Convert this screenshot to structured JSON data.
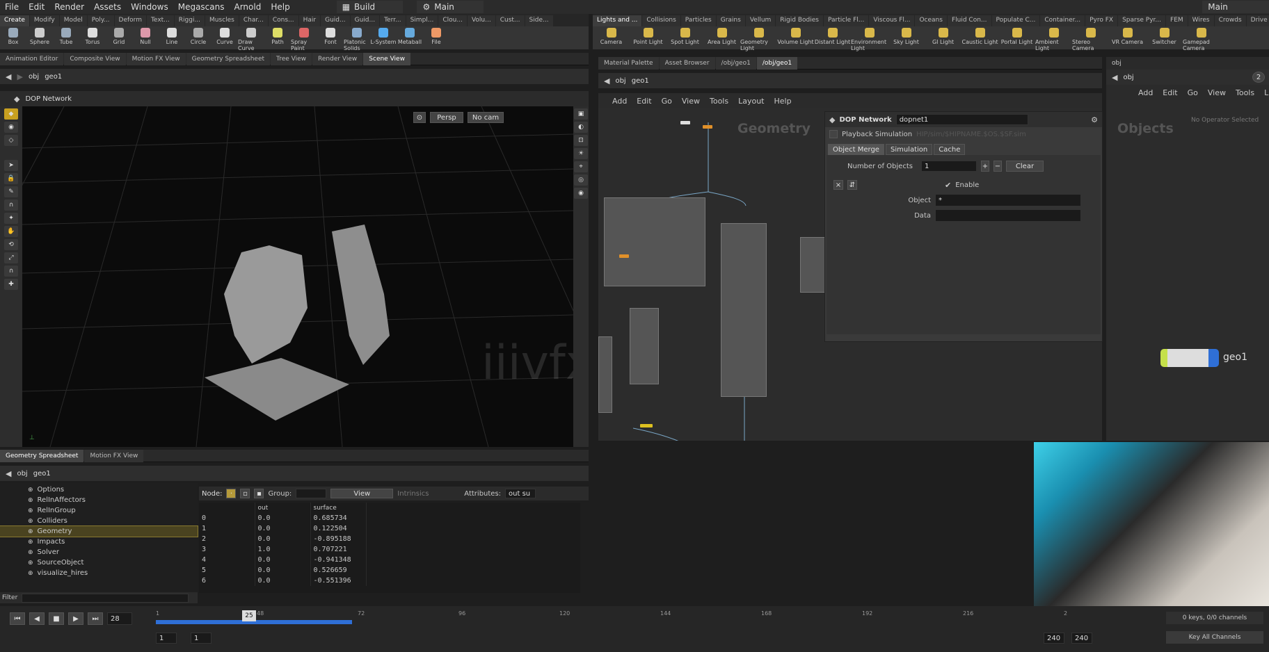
{
  "menubar": {
    "items": [
      "File",
      "Edit",
      "Render",
      "Assets",
      "Windows",
      "Megascans",
      "Arnold",
      "Help"
    ],
    "desktop": "Build",
    "session": "Main",
    "right_session": "Main"
  },
  "shelf_tabs": [
    "Create",
    "Modify",
    "Model",
    "Poly...",
    "Deform",
    "Text...",
    "Riggi...",
    "Muscles",
    "Char...",
    "Cons...",
    "Hair",
    "Guid...",
    "Guid...",
    "Terr...",
    "Simpl...",
    "Clou...",
    "Volu...",
    "Cust...",
    "Side..."
  ],
  "shelf_tools": [
    "Box",
    "Sphere",
    "Tube",
    "Torus",
    "Grid",
    "Null",
    "Line",
    "Circle",
    "Curve",
    "Draw Curve",
    "Path",
    "Spray Paint",
    "Font",
    "Platonic Solids",
    "L-System",
    "Metaball",
    "File"
  ],
  "light_tabs": [
    "Lights and ...",
    "Collisions",
    "Particles",
    "Grains",
    "Vellum",
    "Rigid Bodies",
    "Particle Fl...",
    "Viscous Fl...",
    "Oceans",
    "Fluid Con...",
    "Populate C...",
    "Container...",
    "Pyro FX",
    "Sparse Pyr...",
    "FEM",
    "Wires",
    "Crowds",
    "Drive Sim..."
  ],
  "light_tools": [
    "Camera",
    "Point Light",
    "Spot Light",
    "Area Light",
    "Geometry Light",
    "Volume Light",
    "Distant Light",
    "Environment Light",
    "Sky Light",
    "GI Light",
    "Caustic Light",
    "Portal Light",
    "Ambient Light",
    "Stereo Camera",
    "VR Camera",
    "Switcher",
    "Gamepad Camera"
  ],
  "left_tabs": [
    "Animation Editor",
    "Composite View",
    "Motion FX View",
    "Geometry Spreadsheet",
    "Tree View",
    "Render View",
    "Scene View"
  ],
  "path": {
    "root": "obj",
    "node": "geo1"
  },
  "viewport": {
    "title": "DOP Network",
    "persp": "Persp",
    "cam": "No cam"
  },
  "bottom_tabs": [
    "Geometry Spreadsheet",
    "Motion FX View"
  ],
  "tree_items": [
    "Options",
    "RelInAffectors",
    "RelInGroup",
    "Colliders",
    "Geometry",
    "Impacts",
    "Solver",
    "SourceObject",
    "visualize_hires"
  ],
  "sheet": {
    "node_label": "Node:",
    "group_label": "Group:",
    "view_label": "View",
    "intrinsics_label": "Intrinsics",
    "attributes_label": "Attributes:",
    "attributes_value": "out su",
    "columns": [
      "out",
      "surface"
    ],
    "rows": [
      [
        "0",
        "0.0",
        "0.685734"
      ],
      [
        "1",
        "0.0",
        "0.122504"
      ],
      [
        "2",
        "0.0",
        "-0.895188"
      ],
      [
        "3",
        "1.0",
        "0.707221"
      ],
      [
        "4",
        "0.0",
        "-0.941348"
      ],
      [
        "5",
        "0.0",
        "0.526659"
      ],
      [
        "6",
        "0.0",
        "-0.551396"
      ]
    ]
  },
  "filter_label": "Filter",
  "net_tabs": [
    "Material Palette",
    "Asset Browser",
    "/obj/geo1",
    "/obj/geo1"
  ],
  "net_menu": [
    "Add",
    "Edit",
    "Go",
    "View",
    "Tools",
    "Layout",
    "Help"
  ],
  "net_context": "Geometry",
  "params": {
    "type": "DOP Network",
    "name": "dopnet1",
    "playback": "Playback Simulation",
    "sim_path": "HIP/sim/$HIPNAME.$OS.$SF.sim",
    "tabs": [
      "Object Merge",
      "Simulation",
      "Cache"
    ],
    "num_objects_label": "Number of Objects",
    "num_objects": "1",
    "clear": "Clear",
    "enable": "Enable",
    "object_label": "Object",
    "object_value": "*",
    "data_label": "Data"
  },
  "right_net": {
    "path": "obj",
    "menu": [
      "Add",
      "Edit",
      "Go",
      "View",
      "Tools",
      "L"
    ],
    "context": "Objects",
    "no_op": "No Operator Selected",
    "node": "geo1",
    "count": "2"
  },
  "watermark": "iiivfx.com",
  "timeline": {
    "frame": "28",
    "cursor": "25",
    "ticks": [
      "1",
      "48",
      "72",
      "96",
      "120",
      "144",
      "168",
      "192",
      "216",
      "2"
    ],
    "start": "1",
    "start2": "1",
    "end": "240",
    "end2": "240",
    "keys": "0 keys, 0/0 channels",
    "key_all": "Key All Channels"
  },
  "colors": {
    "accent": "#2f6fd6",
    "selected": "#f0a030"
  }
}
